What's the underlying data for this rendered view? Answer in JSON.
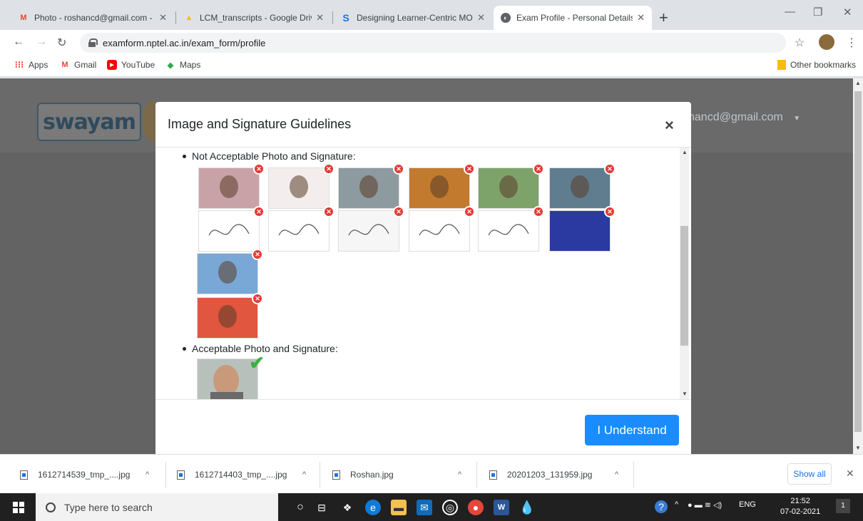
{
  "browser": {
    "tabs": [
      {
        "title": "Photo - roshancd@gmail.com - (",
        "icon": "gmail-icon",
        "active": false
      },
      {
        "title": "LCM_transcripts - Google Drive",
        "icon": "drive-icon",
        "active": false
      },
      {
        "title": "Designing Learner-Centric MOO(",
        "icon": "s-icon",
        "active": false
      },
      {
        "title": "Exam Profile - Personal Details",
        "icon": "globe-icon",
        "active": true
      }
    ],
    "address": "examform.nptel.ac.in/exam_form/profile",
    "bookmarks": [
      {
        "label": "Apps",
        "icon": "apps-grid-icon"
      },
      {
        "label": "Gmail",
        "icon": "gmail-icon"
      },
      {
        "label": "YouTube",
        "icon": "youtube-icon"
      },
      {
        "label": "Maps",
        "icon": "maps-icon"
      }
    ],
    "other_bookmarks": "Other bookmarks"
  },
  "site": {
    "logo_text": "swayam",
    "user_email": "hancd@gmail.com"
  },
  "modal": {
    "title": "Image and Signature Guidelines",
    "close_glyph": "×",
    "not_acceptable_label": "Not Acceptable Photo and Signature:",
    "acceptable_label": "Acceptable Photo and Signature:",
    "button_label": "I Understand",
    "not_acceptable_images": [
      {
        "kind": "photo",
        "color": "#c9a2a8"
      },
      {
        "kind": "photo",
        "color": "#f4eded"
      },
      {
        "kind": "photo",
        "color": "#8d9aa0"
      },
      {
        "kind": "photo",
        "color": "#c27a2e"
      },
      {
        "kind": "photo",
        "color": "#7ea36a"
      },
      {
        "kind": "photo",
        "color": "#5f7d8f"
      },
      {
        "kind": "signature",
        "color": "#ffffff"
      },
      {
        "kind": "signature",
        "color": "#ffffff"
      },
      {
        "kind": "signature",
        "color": "#f6f6f6"
      },
      {
        "kind": "signature",
        "color": "#ffffff"
      },
      {
        "kind": "signature",
        "color": "#ffffff"
      },
      {
        "kind": "thumbprint",
        "color": "#2b3aa0"
      },
      {
        "kind": "photo",
        "color": "#7aa8d6"
      },
      {
        "kind": "photo",
        "color": "#e0563f"
      }
    ],
    "acceptable_images": [
      {
        "kind": "photo",
        "color": "#9aa7a0"
      }
    ]
  },
  "downloads": {
    "items": [
      {
        "name": "1612714539_tmp_....jpg"
      },
      {
        "name": "1612714403_tmp_....jpg"
      },
      {
        "name": "Roshan.jpg"
      },
      {
        "name": "20201203_131959.jpg"
      }
    ],
    "show_all": "Show all"
  },
  "taskbar": {
    "search_placeholder": "Type here to search",
    "lang": "ENG",
    "time": "21:52",
    "date": "07-02-2021",
    "notification_count": "1"
  }
}
